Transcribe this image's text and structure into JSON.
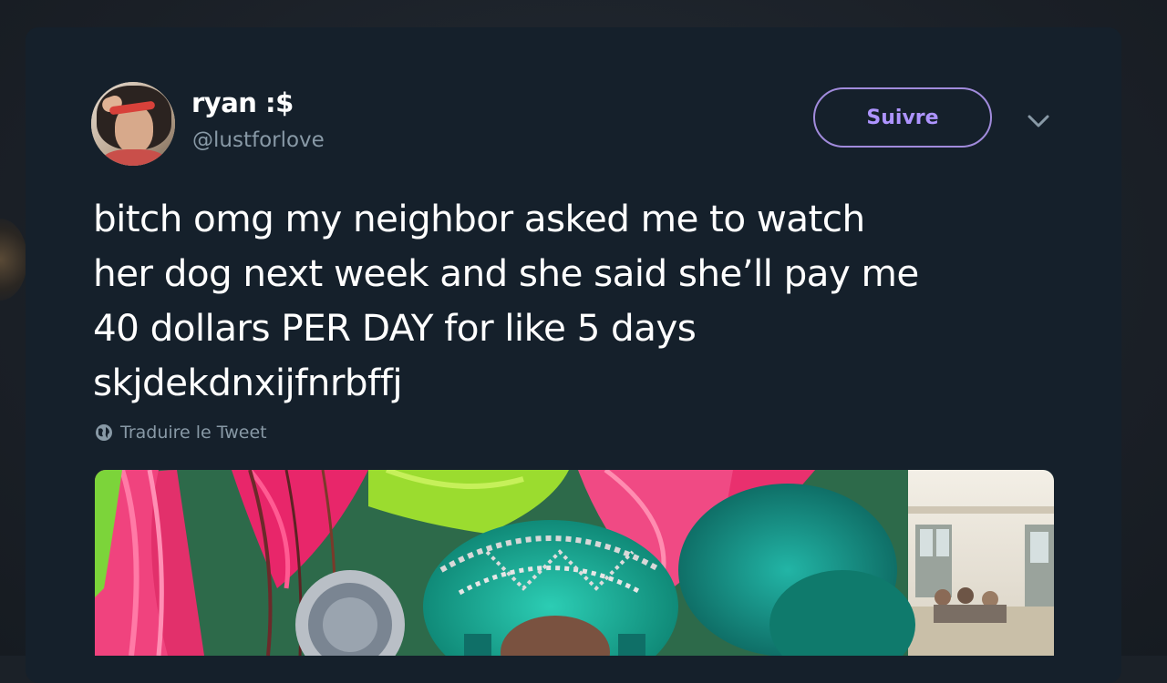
{
  "tweet": {
    "author": {
      "display_name": "ryan :$",
      "handle": "@lustforlove",
      "avatar_icon": "profile-photo"
    },
    "follow_label": "Suivre",
    "menu_icon": "chevron-down-icon",
    "text": "bitch omg my neighbor asked me to watch\nher dog next week and she said she’ll pay me\n40 dollars PER DAY for like 5 days\nskjdekdnxijfnrbffj",
    "translate_label": "Traduire le Tweet",
    "translate_icon": "globe-icon",
    "media_description_icon": "photo-carnival-costume"
  },
  "colors": {
    "card_bg": "#15202b",
    "accent": "#ae94ff",
    "secondary_text": "#8899a6",
    "text": "#ffffff"
  }
}
